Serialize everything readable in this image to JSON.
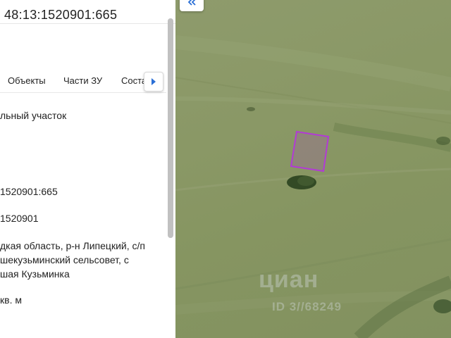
{
  "panel": {
    "cadastral_number": "48:13:1520901:665",
    "tabs": [
      {
        "label": "Объекты"
      },
      {
        "label": "Части ЗУ"
      },
      {
        "label": "Соста"
      }
    ],
    "rows": {
      "type_value": "льный участок",
      "cad_number_value": "1520901:665",
      "cad_quarter_value": "1520901",
      "address_line1": "дкая область, р-н Липецкий, с/п",
      "address_line2": "шекузьминский сельсовет, с",
      "address_line3": "шая Кузьминка",
      "area_value": "кв. м"
    }
  },
  "map": {
    "watermark": "циан",
    "watermark_id": "ID 3//68249"
  },
  "colors": {
    "parcel_outline": "#b23ad6",
    "field": "#8a9866"
  }
}
